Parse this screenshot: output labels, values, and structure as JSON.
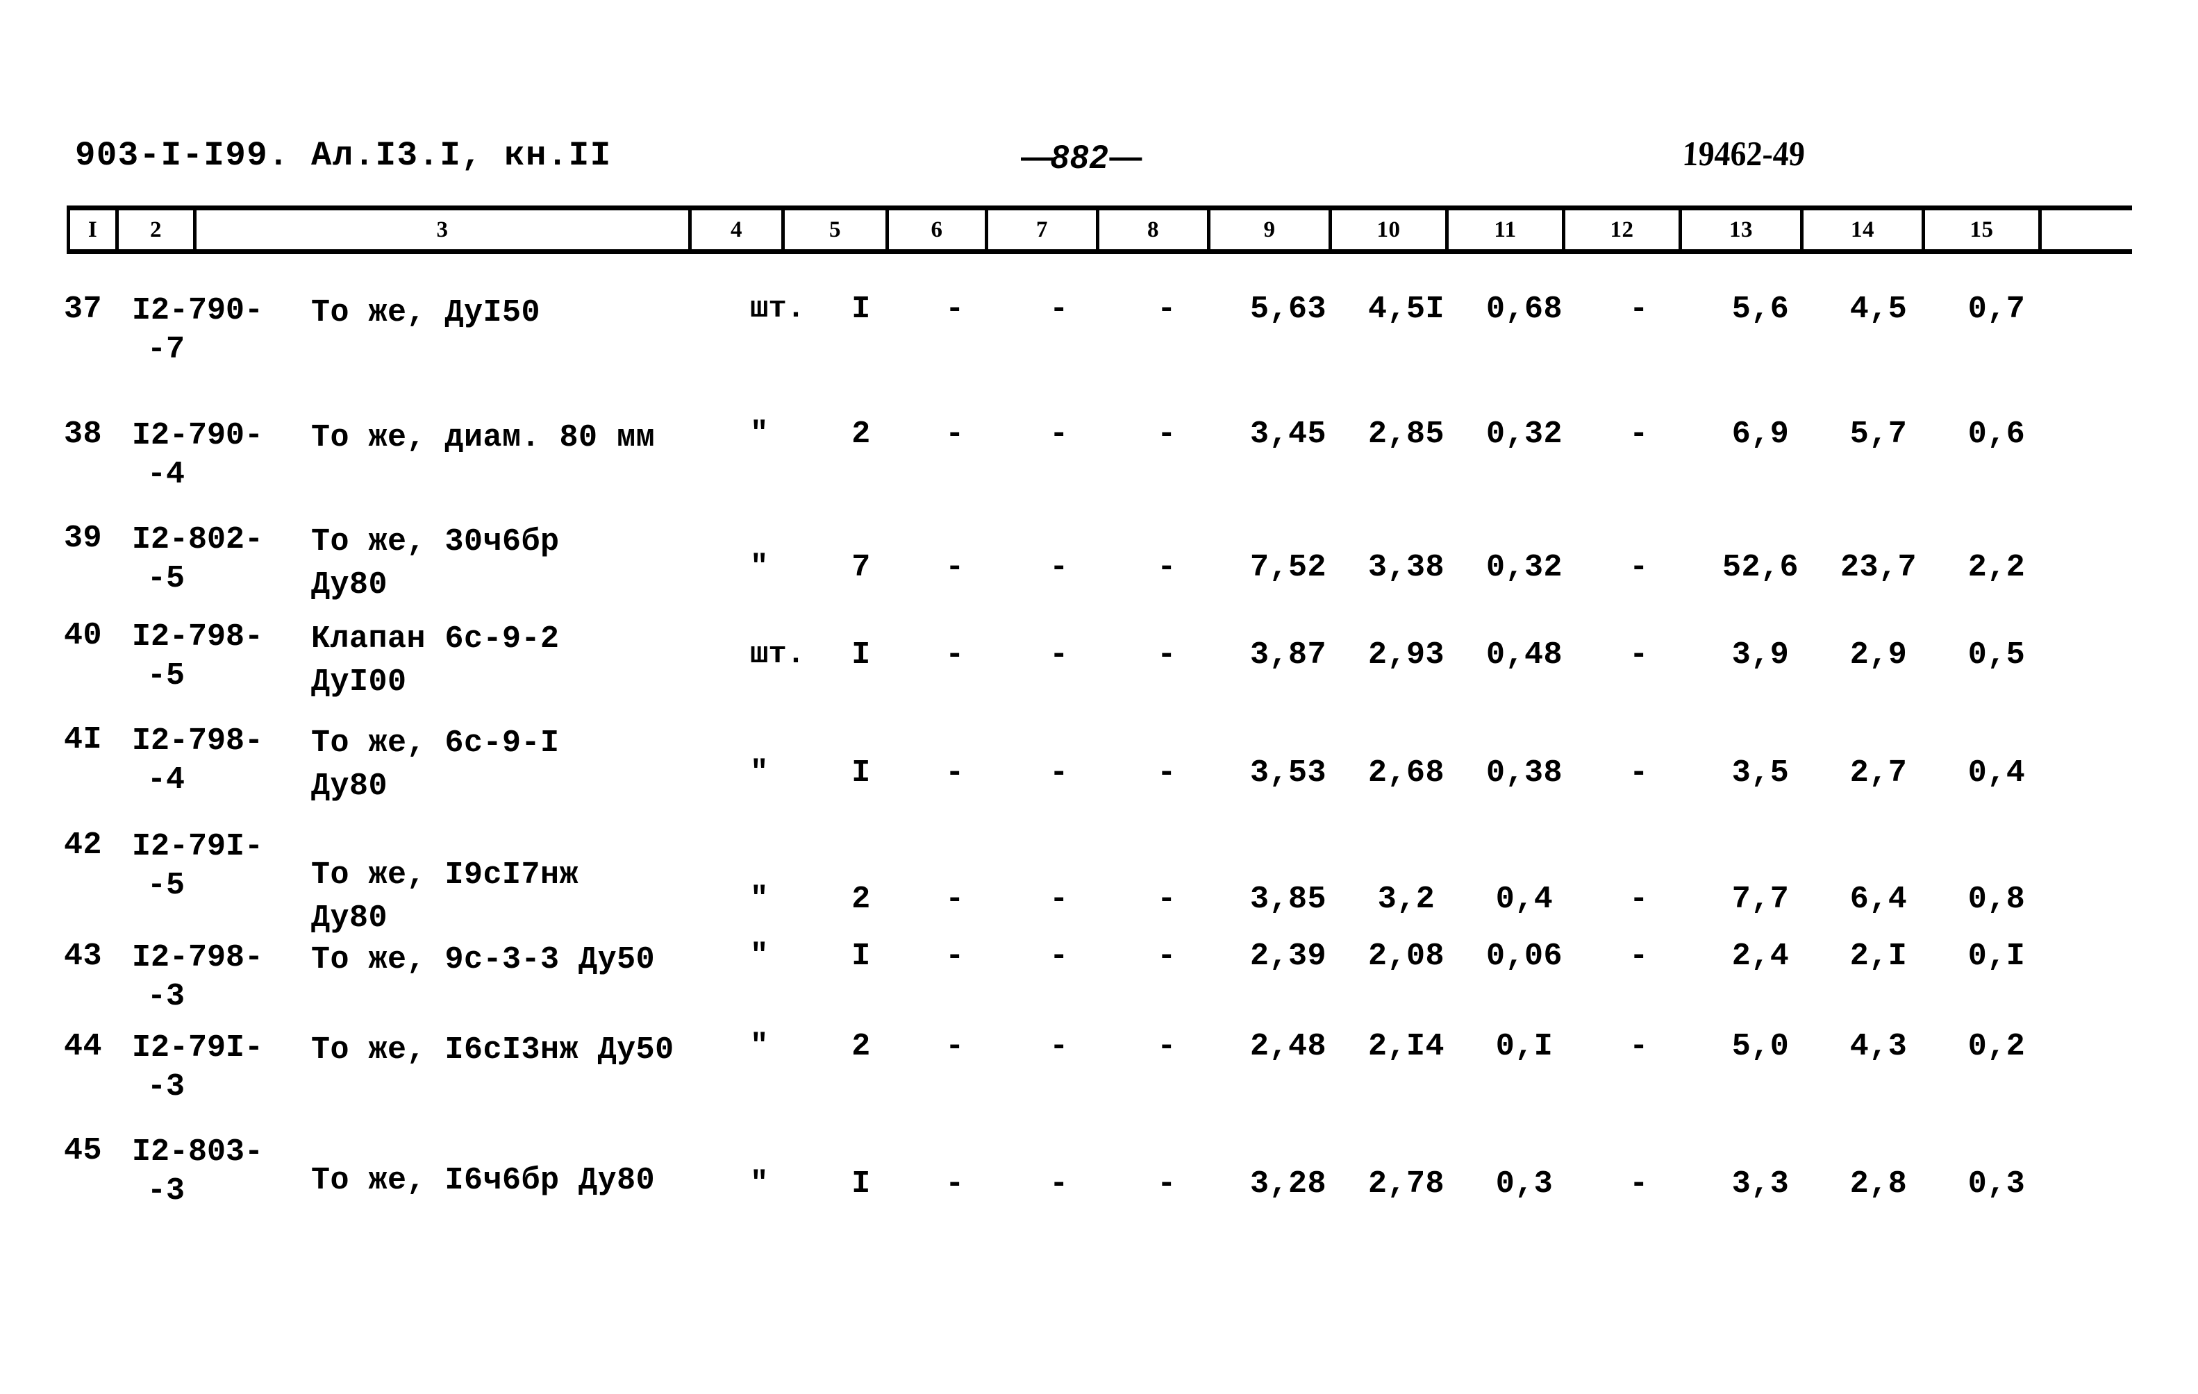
{
  "document": {
    "header_left": "903-I-I99. Ал.I3.I, кн.II",
    "page_marker_dash_left": "—",
    "page_number": "882",
    "page_marker_dash_right": "—",
    "header_right": "19462-49"
  },
  "table": {
    "column_headers": [
      "I",
      "2",
      "3",
      "4",
      "5",
      "6",
      "7",
      "8",
      "9",
      "10",
      "11",
      "12",
      "13",
      "14",
      "15"
    ],
    "rows": [
      {
        "num": "37",
        "code_line1": "I2-790-",
        "code_line2": "-7",
        "desc_line1": "То же, ДуI50",
        "desc_line2": "",
        "unit": "шт.",
        "c5": "I",
        "c6": "-",
        "c7": "-",
        "c8": "-",
        "c9": "5,63",
        "c10": "4,5I",
        "c11": "0,68",
        "c12": "-",
        "c13": "5,6",
        "c14": "4,5",
        "c15": "0,7"
      },
      {
        "num": "38",
        "code_line1": "I2-790-",
        "code_line2": "-4",
        "desc_line1": "То же, диам. 80 мм",
        "desc_line2": "",
        "unit": "\"",
        "c5": "2",
        "c6": "-",
        "c7": "-",
        "c8": "-",
        "c9": "3,45",
        "c10": "2,85",
        "c11": "0,32",
        "c12": "-",
        "c13": "6,9",
        "c14": "5,7",
        "c15": "0,6"
      },
      {
        "num": "39",
        "code_line1": "I2-802-",
        "code_line2": "-5",
        "desc_line1": "То же, 30ч6бр",
        "desc_line2": "Ду80",
        "unit": "\"",
        "c5": "7",
        "c6": "-",
        "c7": "-",
        "c8": "-",
        "c9": "7,52",
        "c10": "3,38",
        "c11": "0,32",
        "c12": "-",
        "c13": "52,6",
        "c14": "23,7",
        "c15": "2,2"
      },
      {
        "num": "40",
        "code_line1": "I2-798-",
        "code_line2": "-5",
        "desc_line1": "Клапан 6с-9-2",
        "desc_line2": "ДуI00",
        "unit": "шт.",
        "c5": "I",
        "c6": "-",
        "c7": "-",
        "c8": "-",
        "c9": "3,87",
        "c10": "2,93",
        "c11": "0,48",
        "c12": "-",
        "c13": "3,9",
        "c14": "2,9",
        "c15": "0,5"
      },
      {
        "num": "4I",
        "code_line1": "I2-798-",
        "code_line2": "-4",
        "desc_line1": "То же, 6с-9-I",
        "desc_line2": "Ду80",
        "unit": "\"",
        "c5": "I",
        "c6": "-",
        "c7": "-",
        "c8": "-",
        "c9": "3,53",
        "c10": "2,68",
        "c11": "0,38",
        "c12": "-",
        "c13": "3,5",
        "c14": "2,7",
        "c15": "0,4"
      },
      {
        "num": "42",
        "code_line1": "I2-79I-",
        "code_line2": "-5",
        "desc_line1": "То же, I9сI7нж",
        "desc_line2": "Ду80",
        "unit": "\"",
        "c5": "2",
        "c6": "-",
        "c7": "-",
        "c8": "-",
        "c9": "3,85",
        "c10": "3,2",
        "c11": "0,4",
        "c12": "-",
        "c13": "7,7",
        "c14": "6,4",
        "c15": "0,8"
      },
      {
        "num": "43",
        "code_line1": "I2-798-",
        "code_line2": "-3",
        "desc_line1": "То же, 9с-3-3 Ду50",
        "desc_line2": "",
        "unit": "\"",
        "c5": "I",
        "c6": "-",
        "c7": "-",
        "c8": "-",
        "c9": "2,39",
        "c10": "2,08",
        "c11": "0,06",
        "c12": "-",
        "c13": "2,4",
        "c14": "2,I",
        "c15": "0,I"
      },
      {
        "num": "44",
        "code_line1": "I2-79I-",
        "code_line2": "-3",
        "desc_line1": "То же, I6сI3нж Ду50",
        "desc_line2": "",
        "unit": "\"",
        "c5": "2",
        "c6": "-",
        "c7": "-",
        "c8": "-",
        "c9": "2,48",
        "c10": "2,I4",
        "c11": "0,I",
        "c12": "-",
        "c13": "5,0",
        "c14": "4,3",
        "c15": "0,2"
      },
      {
        "num": "45",
        "code_line1": "I2-803-",
        "code_line2": "-3",
        "desc_line1": "То же, I6ч6бр Ду80",
        "desc_line2": "",
        "unit": "\"",
        "c5": "I",
        "c6": "-",
        "c7": "-",
        "c8": "-",
        "c9": "3,28",
        "c10": "2,78",
        "c11": "0,3",
        "c12": "-",
        "c13": "3,3",
        "c14": "2,8",
        "c15": "0,3"
      }
    ]
  }
}
